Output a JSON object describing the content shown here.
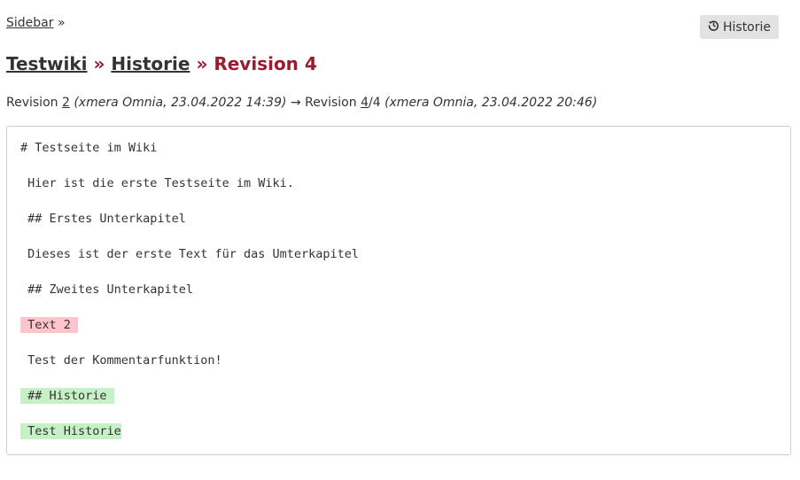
{
  "breadcrumb": {
    "link": "Sidebar",
    "separator": "»"
  },
  "history_button": {
    "label": "Historie",
    "icon": "history-icon"
  },
  "title": {
    "wiki": "Testwiki",
    "sep1": "»",
    "history": "Historie",
    "sep2": "»",
    "current": "Revision 4"
  },
  "revision_line": {
    "prefix": "Revision",
    "from_rev": "2",
    "from_meta": "(xmera Omnia, 23.04.2022 14:39)",
    "arrow": "→",
    "to_label": "Revision",
    "to_rev": "4",
    "to_total": "/4",
    "to_meta": "(xmera Omnia, 23.04.2022 20:46)"
  },
  "diff_lines": [
    {
      "text": "# Testseite im Wiki",
      "type": "context"
    },
    {
      "text": " Hier ist die erste Testseite im Wiki.",
      "type": "context"
    },
    {
      "text": " ## Erstes Unterkapitel",
      "type": "context"
    },
    {
      "text": " Dieses ist der erste Text für das Umterkapitel",
      "type": "context"
    },
    {
      "text": " ## Zweites Unterkapitel",
      "type": "context"
    },
    {
      "text": " Text 2 ",
      "type": "deleted"
    },
    {
      "text": " Test der Kommentarfunktion!",
      "type": "context"
    },
    {
      "text": " ## Historie ",
      "type": "added"
    },
    {
      "text": " Test Historie",
      "type": "added"
    }
  ],
  "colors": {
    "deleted": "#ffc4cc",
    "added": "#c6f0c6",
    "title_accent": "#9b1b30"
  }
}
